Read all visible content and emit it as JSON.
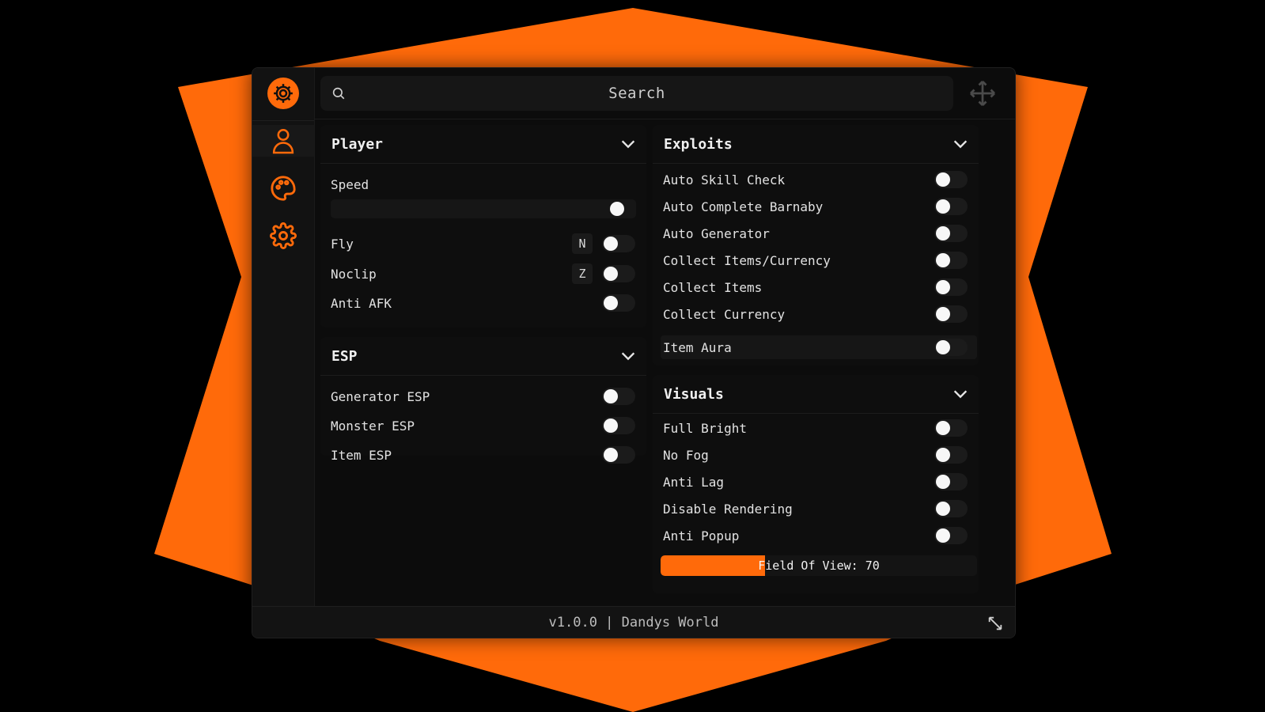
{
  "colors": {
    "accent": "#ff6a0a",
    "background": "#000000",
    "panel": "#0c0c0c",
    "toggle_knob": "#f7f7f7"
  },
  "icons": {
    "logo": "gear-icon",
    "rail": [
      "user-icon",
      "palette-icon",
      "gear-icon"
    ],
    "search": "search-icon",
    "move": "move-icon",
    "resize": "resize-icon",
    "collapse": "chevron-down-icon"
  },
  "search": {
    "placeholder": "Search"
  },
  "sections": {
    "player": {
      "title": "Player",
      "speed_label": "Speed",
      "speed_value": 1.0,
      "fly_label": "Fly",
      "fly_key": "N",
      "noclip_label": "Noclip",
      "noclip_key": "Z",
      "anti_afk_label": "Anti AFK"
    },
    "esp": {
      "title": "ESP",
      "items": [
        "Generator ESP",
        "Monster ESP",
        "Item ESP"
      ]
    },
    "exploits": {
      "title": "Exploits",
      "items": [
        "Auto Skill Check",
        "Auto Complete Barnaby",
        "Auto Generator",
        "Collect Items/Currency",
        "Collect Items",
        "Collect Currency"
      ],
      "item_aura": "Item Aura"
    },
    "visuals": {
      "title": "Visuals",
      "items": [
        "Full Bright",
        "No Fog",
        "Anti Lag",
        "Disable Rendering",
        "Anti Popup"
      ],
      "fov_label": "Field Of View: 70",
      "fov_fill": 0.33
    }
  },
  "footer": {
    "text": "v1.0.0 | Dandys World"
  }
}
